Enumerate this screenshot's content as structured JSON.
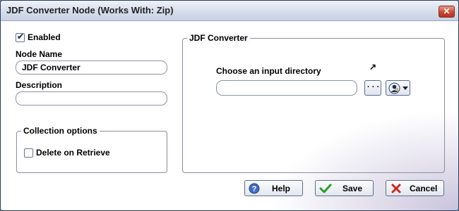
{
  "window": {
    "title": "JDF Converter Node (Works With: Zip)",
    "close_glyph": "✕"
  },
  "general": {
    "enabled_label": "Enabled",
    "enabled_checked": true,
    "node_name_label": "Node Name",
    "node_name_value": "JDF Converter",
    "description_label": "Description",
    "description_value": ""
  },
  "collection": {
    "legend": "Collection options",
    "delete_on_retrieve_label": "Delete on Retrieve",
    "delete_on_retrieve_checked": false
  },
  "converter": {
    "legend": "JDF Converter",
    "input_dir_label": "Choose an input directory",
    "input_dir_value": "",
    "browse_label": "· · ·",
    "arrow_glyph": "↗"
  },
  "buttons": {
    "help": "Help",
    "save": "Save",
    "cancel": "Cancel"
  },
  "colors": {
    "title_bg": "#d6deec",
    "close_red": "#c8442e",
    "save_green": "#2e9b2e",
    "cancel_red": "#d0261c"
  }
}
